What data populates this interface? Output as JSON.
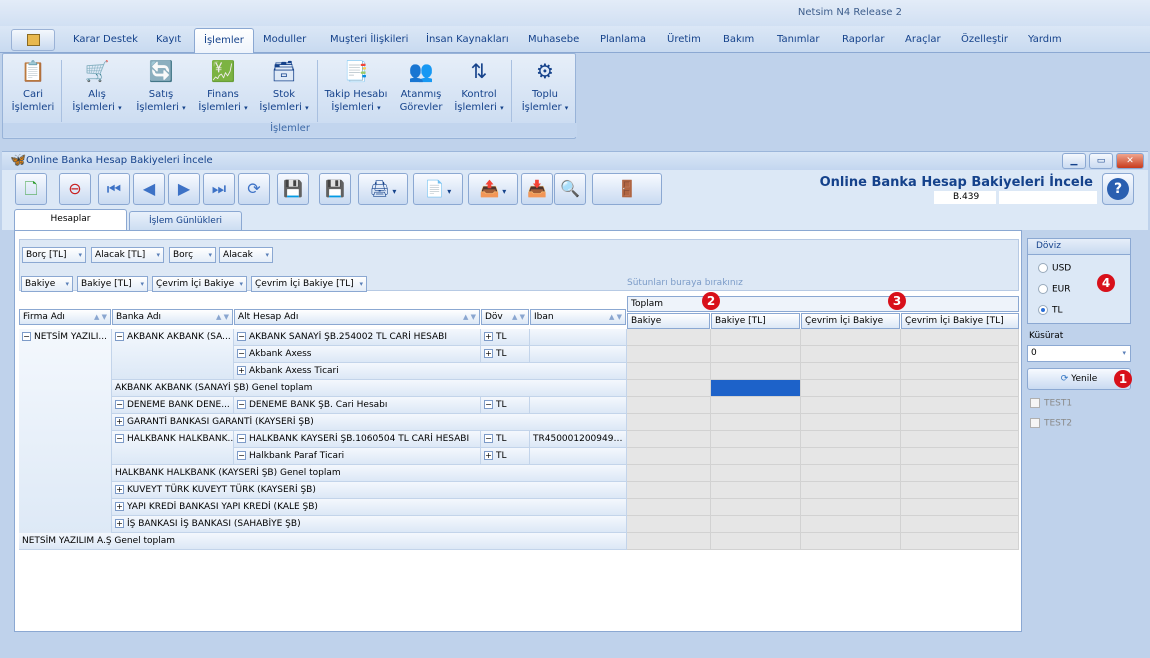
{
  "app_title": "Netsim N4 Release 2",
  "menu": [
    "Karar Destek",
    "Kayıt",
    "İşlemler",
    "Moduller",
    "Muşteri İlişkileri",
    "İnsan Kaynakları",
    "Muhasebe",
    "Planlama",
    "Üretim",
    "Bakım",
    "Tanımlar",
    "Raporlar",
    "Araçlar",
    "Özelleştir",
    "Yardım"
  ],
  "ribbon": {
    "buttons": [
      {
        "line1": "Cari",
        "line2": "İşlemleri",
        "dropdown": false
      },
      {
        "line1": "Alış",
        "line2": "İşlemleri",
        "dropdown": true
      },
      {
        "line1": "Satış",
        "line2": "İşlemleri",
        "dropdown": true
      },
      {
        "line1": "Finans",
        "line2": "İşlemleri",
        "dropdown": true
      },
      {
        "line1": "Stok",
        "line2": "İşlemleri",
        "dropdown": true
      },
      {
        "line1": "Takip Hesabı",
        "line2": "İşlemleri",
        "dropdown": true
      },
      {
        "line1": "Atanmış",
        "line2": "Görevler",
        "dropdown": false
      },
      {
        "line1": "Kontrol",
        "line2": "İşlemleri",
        "dropdown": true
      },
      {
        "line1": "Toplu",
        "line2": "İşlemler",
        "dropdown": true
      }
    ],
    "group_label": "İşlemler"
  },
  "window": {
    "title": "Online Banka Hesap Bakiyeleri İncele",
    "form_title": "Online Banka Hesap Bakiyeleri İncele",
    "form_code": "B.439"
  },
  "tabs": [
    "Hesaplar",
    "İşlem Günlükleri"
  ],
  "pivot": {
    "data_fields_row1": [
      "Borç [TL]",
      "Alacak [TL]",
      "Borç",
      "Alacak"
    ],
    "data_fields_row2": [
      "Bakiye",
      "Bakiye [TL]",
      "Çevrim İçi Bakiye",
      "Çevrim İçi Bakiye [TL]"
    ],
    "drop_hint": "Sütunları buraya bırakınız",
    "row_headers": [
      "Firma Adı",
      "Banka Adı",
      "Alt Hesap Adı",
      "Döv",
      "Iban"
    ],
    "total_label": "Toplam",
    "data_headers": [
      "Bakiye",
      "Bakiye [TL]",
      "Çevrim İçi Bakiye",
      "Çevrim İçi Bakiye [TL]"
    ],
    "firm": "NETSİM YAZILI...",
    "rows": [
      {
        "bank": "AKBANK AKBANK (SA...",
        "bank_expand": "-",
        "account": "AKBANK SANAYİ ŞB.254002 TL CARİ HESABI",
        "acc_expand": "-",
        "cur": "TL",
        "cur_expand": "+",
        "iban": ""
      },
      {
        "bank": "",
        "bank_expand": "",
        "account": "Akbank Axess",
        "acc_expand": "-",
        "cur": "TL",
        "cur_expand": "+",
        "iban": ""
      },
      {
        "bank": "",
        "bank_expand": "",
        "account": "Akbank Axess Ticari",
        "acc_expand": "+",
        "cur": "",
        "cur_expand": "",
        "iban": ""
      },
      {
        "total": "AKBANK AKBANK (SANAYİ ŞB) Genel toplam"
      },
      {
        "bank": "DENEME BANK DENE...",
        "bank_expand": "-",
        "account": "DENEME BANK ŞB. Cari Hesabı",
        "acc_expand": "-",
        "cur": "TL",
        "cur_expand": "-",
        "iban": ""
      },
      {
        "bankfull": "GARANTİ BANKASI GARANTİ (KAYSERİ ŞB)"
      },
      {
        "bank": "HALKBANK HALKBANK...",
        "bank_expand": "-",
        "account": "HALKBANK KAYSERİ ŞB.1060504 TL CARİ HESABI",
        "acc_expand": "-",
        "cur": "TL",
        "cur_expand": "-",
        "iban": "TR450001200949…"
      },
      {
        "bank": "",
        "bank_expand": "",
        "account": "Halkbank Paraf Ticari",
        "acc_expand": "-",
        "cur": "TL",
        "cur_expand": "+",
        "iban": ""
      },
      {
        "total": "HALKBANK HALKBANK (KAYSERİ ŞB) Genel toplam"
      },
      {
        "bankfull": "KUVEYT TÜRK KUVEYT TÜRK (KAYSERİ ŞB)"
      },
      {
        "bankfull": "YAPI KREDİ BANKASI YAPI KREDİ (KALE ŞB)"
      },
      {
        "bankfull": "İŞ BANKASI İŞ BANKASI (SAHABİYE ŞB)"
      },
      {
        "grandtotal": "NETSİM YAZILIM A.Ş Genel toplam"
      }
    ]
  },
  "doviz": {
    "title": "Döviz",
    "options": [
      "USD",
      "EUR",
      "TL"
    ],
    "selected": "TL"
  },
  "kusurat": {
    "label": "Küsürat",
    "value": "0"
  },
  "yenile_label": "Yenile",
  "checkboxes": [
    "TEST1",
    "TEST2"
  ],
  "badges": [
    "1",
    "2",
    "3",
    "4"
  ]
}
